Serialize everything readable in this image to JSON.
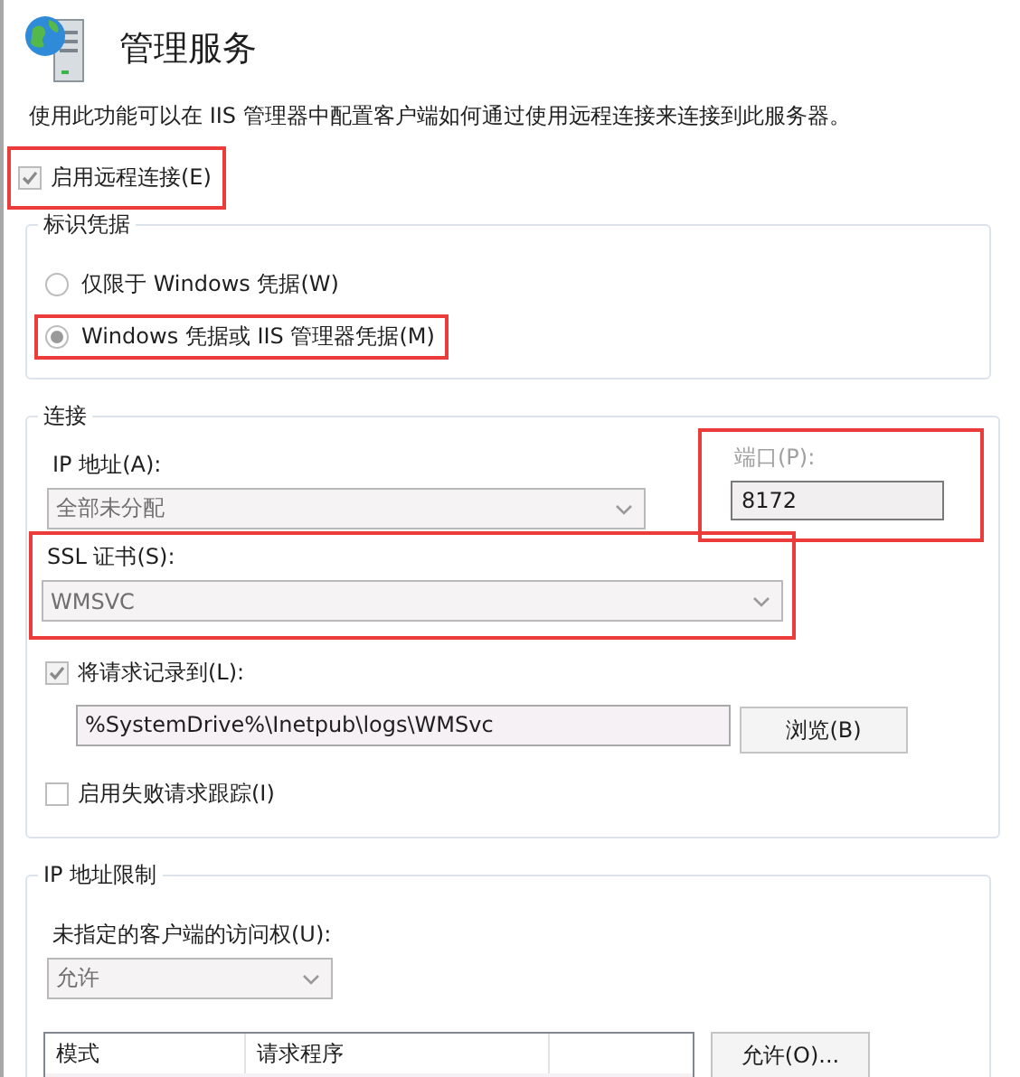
{
  "header": {
    "title": "管理服务"
  },
  "description": "使用此功能可以在 IIS 管理器中配置客户端如何通过使用远程连接来连接到此服务器。",
  "enable_remote": {
    "label": "启用远程连接(E)",
    "checked": true,
    "highlighted": true
  },
  "identity": {
    "title": "标识凭据",
    "options": [
      {
        "label": "仅限于 Windows 凭据(W)",
        "selected": false,
        "highlighted": false
      },
      {
        "label": "Windows 凭据或 IIS 管理器凭据(M)",
        "selected": true,
        "highlighted": true
      }
    ]
  },
  "connection": {
    "title": "连接",
    "ip": {
      "label": "IP 地址(A):",
      "value": "全部未分配"
    },
    "port": {
      "label": "端口(P):",
      "value": "8172",
      "disabled": true,
      "highlighted": true
    },
    "ssl": {
      "label": "SSL 证书(S):",
      "value": "WMSVC",
      "highlighted": true
    },
    "log": {
      "label": "将请求记录到(L):",
      "checked": true
    },
    "log_path": "%SystemDrive%\\Inetpub\\logs\\WMSvc",
    "browse_button": "浏览(B)",
    "failed_trace": {
      "label": "启用失败请求跟踪(I)",
      "checked": false
    }
  },
  "ip_restrictions": {
    "title": "IP 地址限制",
    "access": {
      "label": "未指定的客户端的访问权(U):",
      "value": "允许"
    },
    "table": {
      "columns": [
        "模式",
        "请求程序"
      ]
    },
    "allow_button": "允许(O)..."
  }
}
